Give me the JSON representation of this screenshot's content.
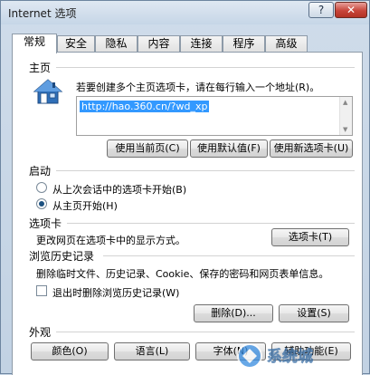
{
  "window": {
    "title": "Internet 选项",
    "help_label": "?",
    "close_label": "✕"
  },
  "tabs": [
    {
      "label": "常规",
      "active": true
    },
    {
      "label": "安全"
    },
    {
      "label": "隐私"
    },
    {
      "label": "内容"
    },
    {
      "label": "连接"
    },
    {
      "label": "程序"
    },
    {
      "label": "高级"
    }
  ],
  "home": {
    "section_label": "主页",
    "icon": "house-icon",
    "description": "若要创建多个主页选项卡，请在每行输入一个地址(R)。",
    "url": "http://hao.360.cn/?wd_xp",
    "btn_current": "使用当前页(C)",
    "btn_default": "使用默认值(F)",
    "btn_new_tab": "使用新选项卡(U)"
  },
  "startup": {
    "section_label": "启动",
    "option_last_session": "从上次会话中的选项卡开始(B)",
    "option_home": "从主页开始(H)",
    "selected": "home"
  },
  "tabs_section": {
    "section_label": "选项卡",
    "description": "更改网页在选项卡中的显示方式。",
    "button": "选项卡(T)"
  },
  "history": {
    "section_label": "浏览历史记录",
    "description": "删除临时文件、历史记录、Cookie、保存的密码和网页表单信息。",
    "checkbox_label": "退出时删除浏览历史记录(W)",
    "checked": false,
    "btn_delete": "删除(D)...",
    "btn_settings": "设置(S)"
  },
  "appearance": {
    "section_label": "外观",
    "btn_colors": "颜色(O)",
    "btn_languages": "语言(L)",
    "btn_fonts": "字体(N)",
    "btn_accessibility": "辅助功能(E)"
  },
  "watermark": {
    "logo_text": "系统城"
  },
  "colors": {
    "selection": "#3399ff",
    "radio_dot": "#1c5180",
    "close_button": "#c8453a"
  }
}
